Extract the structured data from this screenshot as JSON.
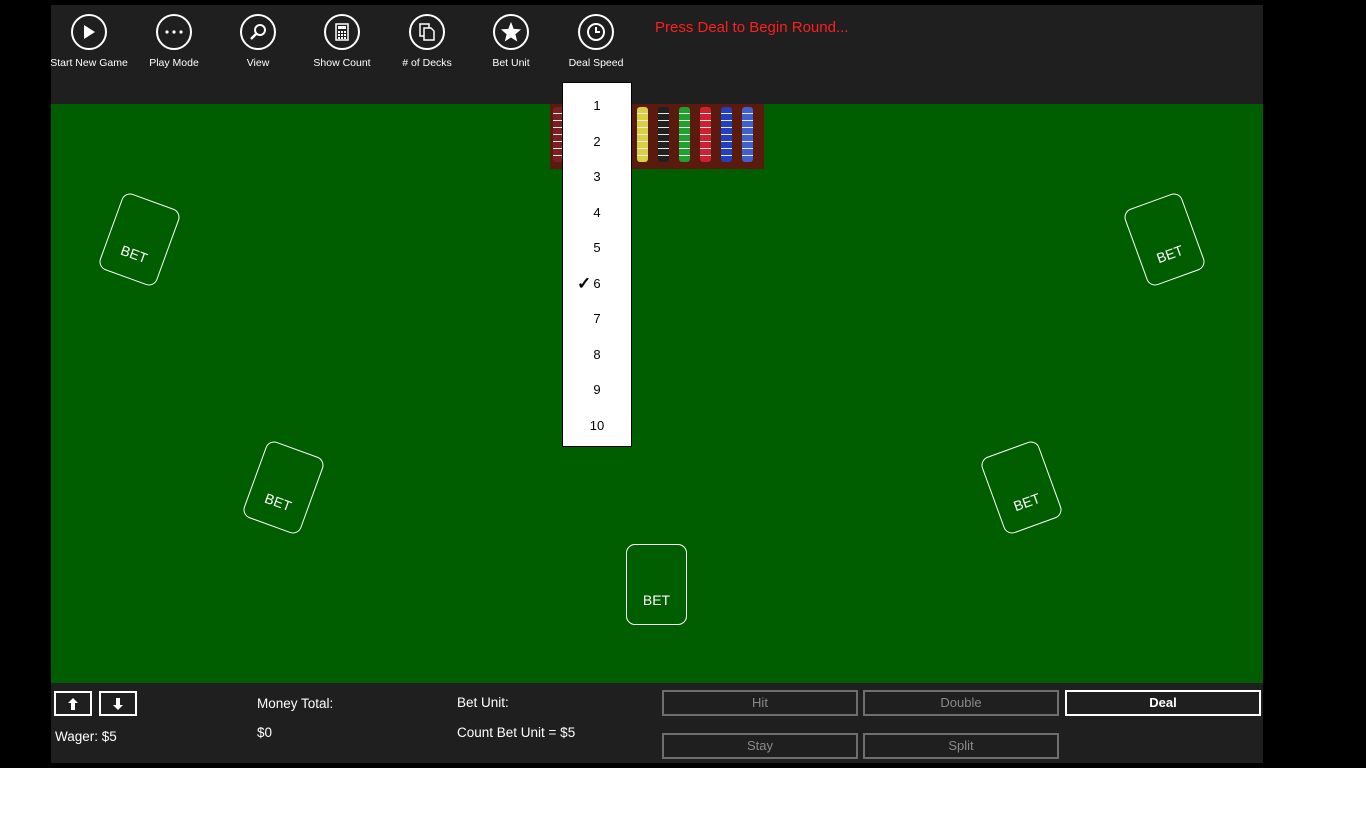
{
  "appbar": {
    "buttons": [
      {
        "label": "Start New Game",
        "icon": "play-icon"
      },
      {
        "label": "Play Mode",
        "icon": "more-icon"
      },
      {
        "label": "View",
        "icon": "zoom-icon"
      },
      {
        "label": "Show Count",
        "icon": "calculator-icon"
      },
      {
        "label": "# of Decks",
        "icon": "copy-icon"
      },
      {
        "label": "Bet Unit",
        "icon": "star-icon"
      },
      {
        "label": "Deal Speed",
        "icon": "clock-icon"
      }
    ],
    "status_message": "Press Deal to Begin Round..."
  },
  "table": {
    "bet_spots": [
      "BET",
      "BET",
      "BET",
      "BET",
      "BET"
    ],
    "felt_color": "#005e00",
    "chip_colors": [
      "#7a2020",
      "#a040c0",
      "#7a2fb0",
      "#c8c8c8",
      "#d8d040",
      "#202020",
      "#20a030",
      "#d02030",
      "#2040c0",
      "#4060d0"
    ]
  },
  "deal_speed_menu": {
    "options": [
      "1",
      "2",
      "3",
      "4",
      "5",
      "6",
      "7",
      "8",
      "9",
      "10"
    ],
    "selected": "6"
  },
  "bottom": {
    "money_total_label": "Money Total:",
    "money_total_value": "$0",
    "bet_unit_label": "Bet Unit:",
    "count_bet_unit": "Count Bet Unit = $5",
    "wager": "Wager: $5",
    "actions": {
      "hit": "Hit",
      "double": "Double",
      "deal": "Deal",
      "stay": "Stay",
      "split": "Split"
    }
  },
  "colors": {
    "status": "#ff1e1e",
    "bar": "#1f1f1f"
  }
}
